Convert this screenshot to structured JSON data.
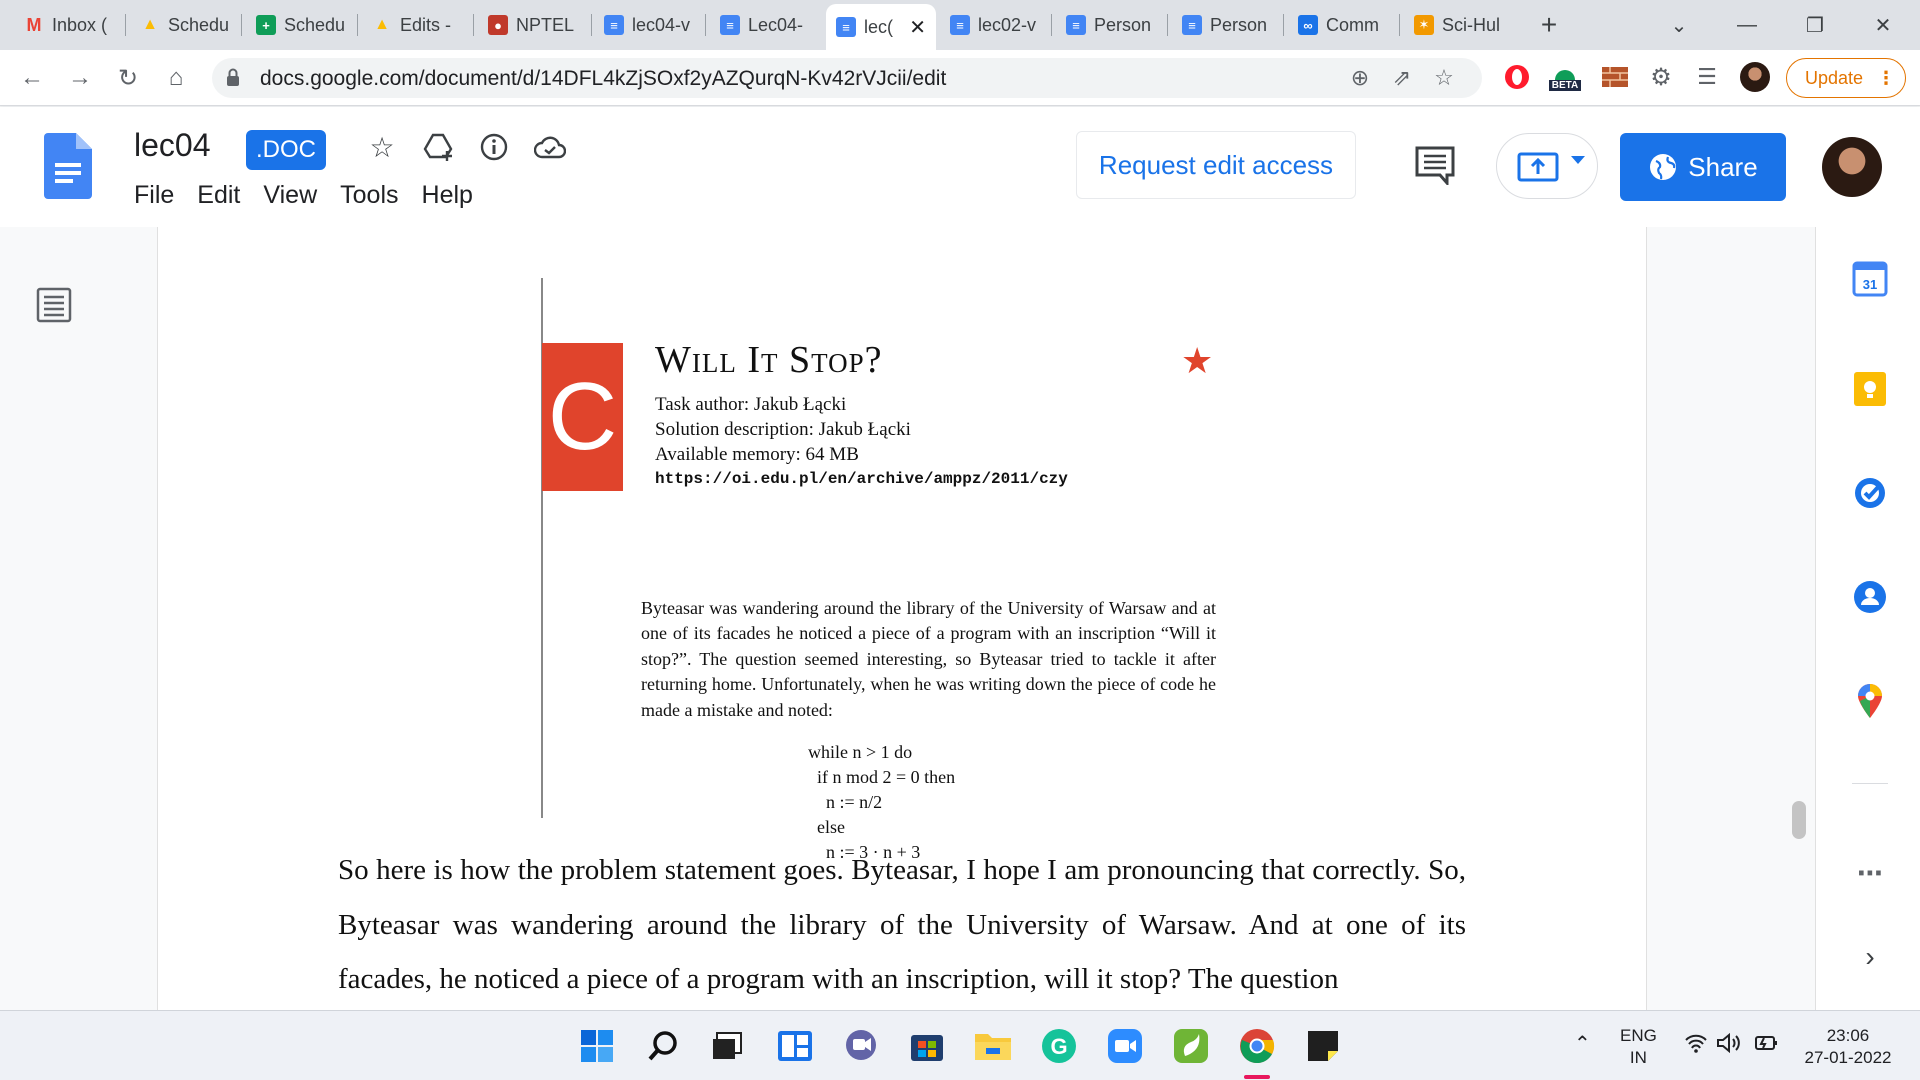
{
  "browser": {
    "tabs": [
      {
        "title": "Inbox (",
        "icon": "gmail-icon",
        "color": "#ea4335"
      },
      {
        "title": "Schedu",
        "icon": "drive-icon",
        "color": "#fbbc04"
      },
      {
        "title": "Schedu",
        "icon": "sheets-icon",
        "color": "#0f9d58"
      },
      {
        "title": "Edits -",
        "icon": "drive-icon",
        "color": "#fbbc04"
      },
      {
        "title": "NPTEL",
        "icon": "nptel-icon",
        "color": "#c0392b"
      },
      {
        "title": "lec04-v",
        "icon": "docs-icon",
        "color": "#4285f4"
      },
      {
        "title": "Lec04-",
        "icon": "docs-icon",
        "color": "#4285f4"
      },
      {
        "title": "lec(",
        "icon": "docs-icon",
        "color": "#4285f4"
      },
      {
        "title": "lec02-v",
        "icon": "docs-icon",
        "color": "#4285f4"
      },
      {
        "title": "Person",
        "icon": "docs-icon",
        "color": "#4285f4"
      },
      {
        "title": "Person",
        "icon": "docs-icon",
        "color": "#4285f4"
      },
      {
        "title": "Comm",
        "icon": "link-icon",
        "color": "#1a73e8"
      },
      {
        "title": "Sci-Hul",
        "icon": "scihub-icon",
        "color": "#f29900"
      }
    ],
    "url": "docs.google.com/document/d/14DFL4kZjSOxf2yAZQurqN-Kv42rVJcii/edit",
    "update_label": "Update",
    "beta_label": "BETA"
  },
  "docs": {
    "title": "lec04",
    "badge": ".DOC",
    "menu": [
      "File",
      "Edit",
      "View",
      "Tools",
      "Help"
    ],
    "request_label": "Request edit access",
    "share_label": "Share",
    "accent": "#1a73e8"
  },
  "embed": {
    "letter": "C",
    "task_title": "Will It Stop?",
    "meta": [
      "Task author: Jakub Łącki",
      "Solution description: Jakub Łącki",
      "Available memory: 64 MB"
    ],
    "link": "https://oi.edu.pl/en/archive/amppz/2011/czy",
    "description": "Byteasar was wandering around the library of the University of Warsaw and at one of its facades he noticed a piece of a program with an inscription “Will it stop?”. The question seemed interesting, so Byteasar tried to tackle it after returning home. Unfortunately, when he was writing down the piece of code he made a mistake and noted:",
    "code": [
      "while n > 1 do",
      "  if n mod 2 = 0 then",
      "    n := n/2",
      "  else",
      "    n := 3 · n + 3"
    ]
  },
  "body_text": "So here is how the problem statement goes. Byteasar, I hope I am pronouncing that correctly. So, Byteasar was wandering around the library of the University of Warsaw. And at one of its facades, he noticed a piece of a program with an inscription, will it stop? The question",
  "taskbar": {
    "lang_top": "ENG",
    "lang_bottom": "IN",
    "time": "23:06",
    "date": "27-01-2022",
    "calendar_day": "31"
  }
}
